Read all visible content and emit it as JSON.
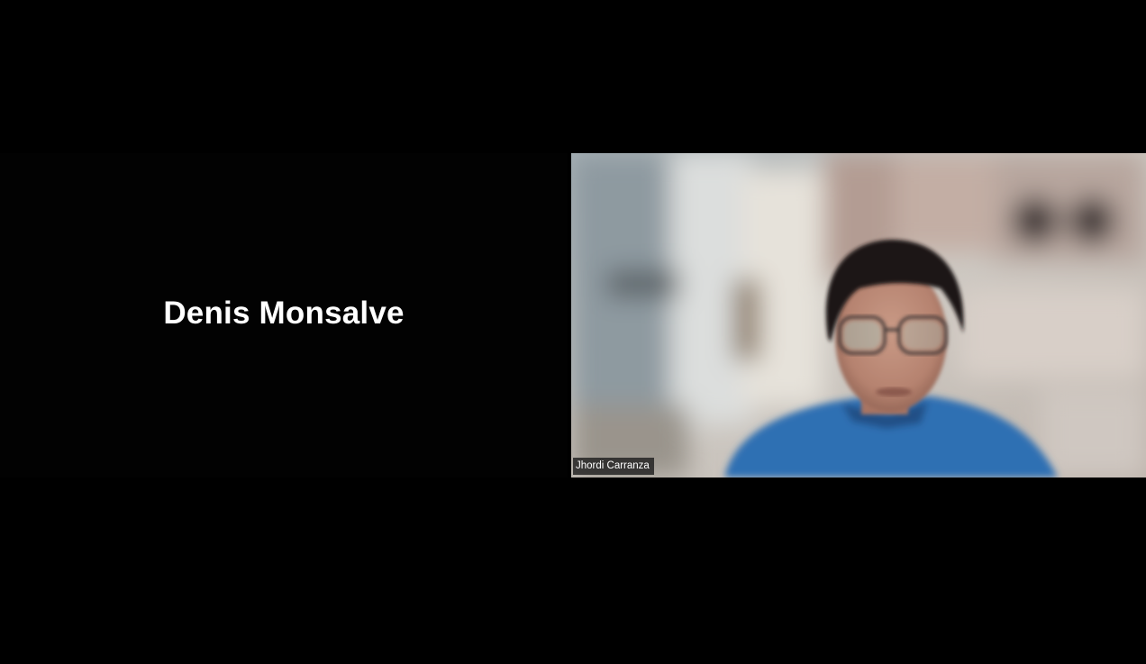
{
  "meeting": {
    "participants": [
      {
        "name": "Denis Monsalve",
        "video_on": false
      },
      {
        "name": "Jhordi Carranza",
        "video_on": true
      }
    ]
  },
  "colors": {
    "background": "#000000",
    "name_text": "#ffffff",
    "shirt": "#2f6fb3",
    "wall": "#c9c6c2"
  },
  "icons": {}
}
